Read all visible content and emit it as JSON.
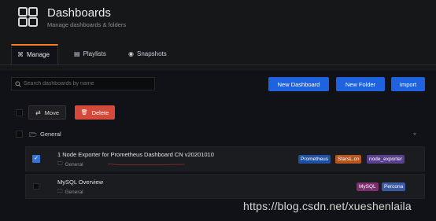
{
  "header": {
    "title": "Dashboards",
    "subtitle": "Manage dashboards & folders",
    "icon": "dashboard-grid-icon"
  },
  "tabs": [
    {
      "label": "Manage",
      "icon": "sitemap-icon",
      "active": true
    },
    {
      "label": "Playlists",
      "icon": "playlist-icon",
      "active": false
    },
    {
      "label": "Snapshots",
      "icon": "camera-icon",
      "active": false
    }
  ],
  "search": {
    "placeholder": "Search dashboards by name",
    "value": ""
  },
  "buttons": {
    "new_dashboard": "New Dashboard",
    "new_folder": "New Folder",
    "import": "Import"
  },
  "actions": {
    "move": "Move",
    "delete": "Delete"
  },
  "folder": {
    "name": "General",
    "expanded": true
  },
  "dashboards": [
    {
      "title": "1 Node Exporter for Prometheus Dashboard CN v20201010",
      "folder": "General",
      "checked": true,
      "tags": [
        {
          "label": "Prometheus",
          "color": "#1f4fa3"
        },
        {
          "label": "StarsL.cn",
          "color": "#b4561e"
        },
        {
          "label": "node_exporter",
          "color": "#5a3f8c"
        }
      ]
    },
    {
      "title": "MySQL Overview",
      "folder": "General",
      "checked": false,
      "tags": [
        {
          "label": "MySQL",
          "color": "#7b2f6e"
        },
        {
          "label": "Percona",
          "color": "#3b5aa3"
        }
      ]
    }
  ],
  "watermark": "https://blog.csdn.net/xueshenlaila",
  "colors": {
    "accent": "#f57c22",
    "primary": "#1f62e0",
    "danger": "#d44a3a",
    "background": "#111217"
  }
}
